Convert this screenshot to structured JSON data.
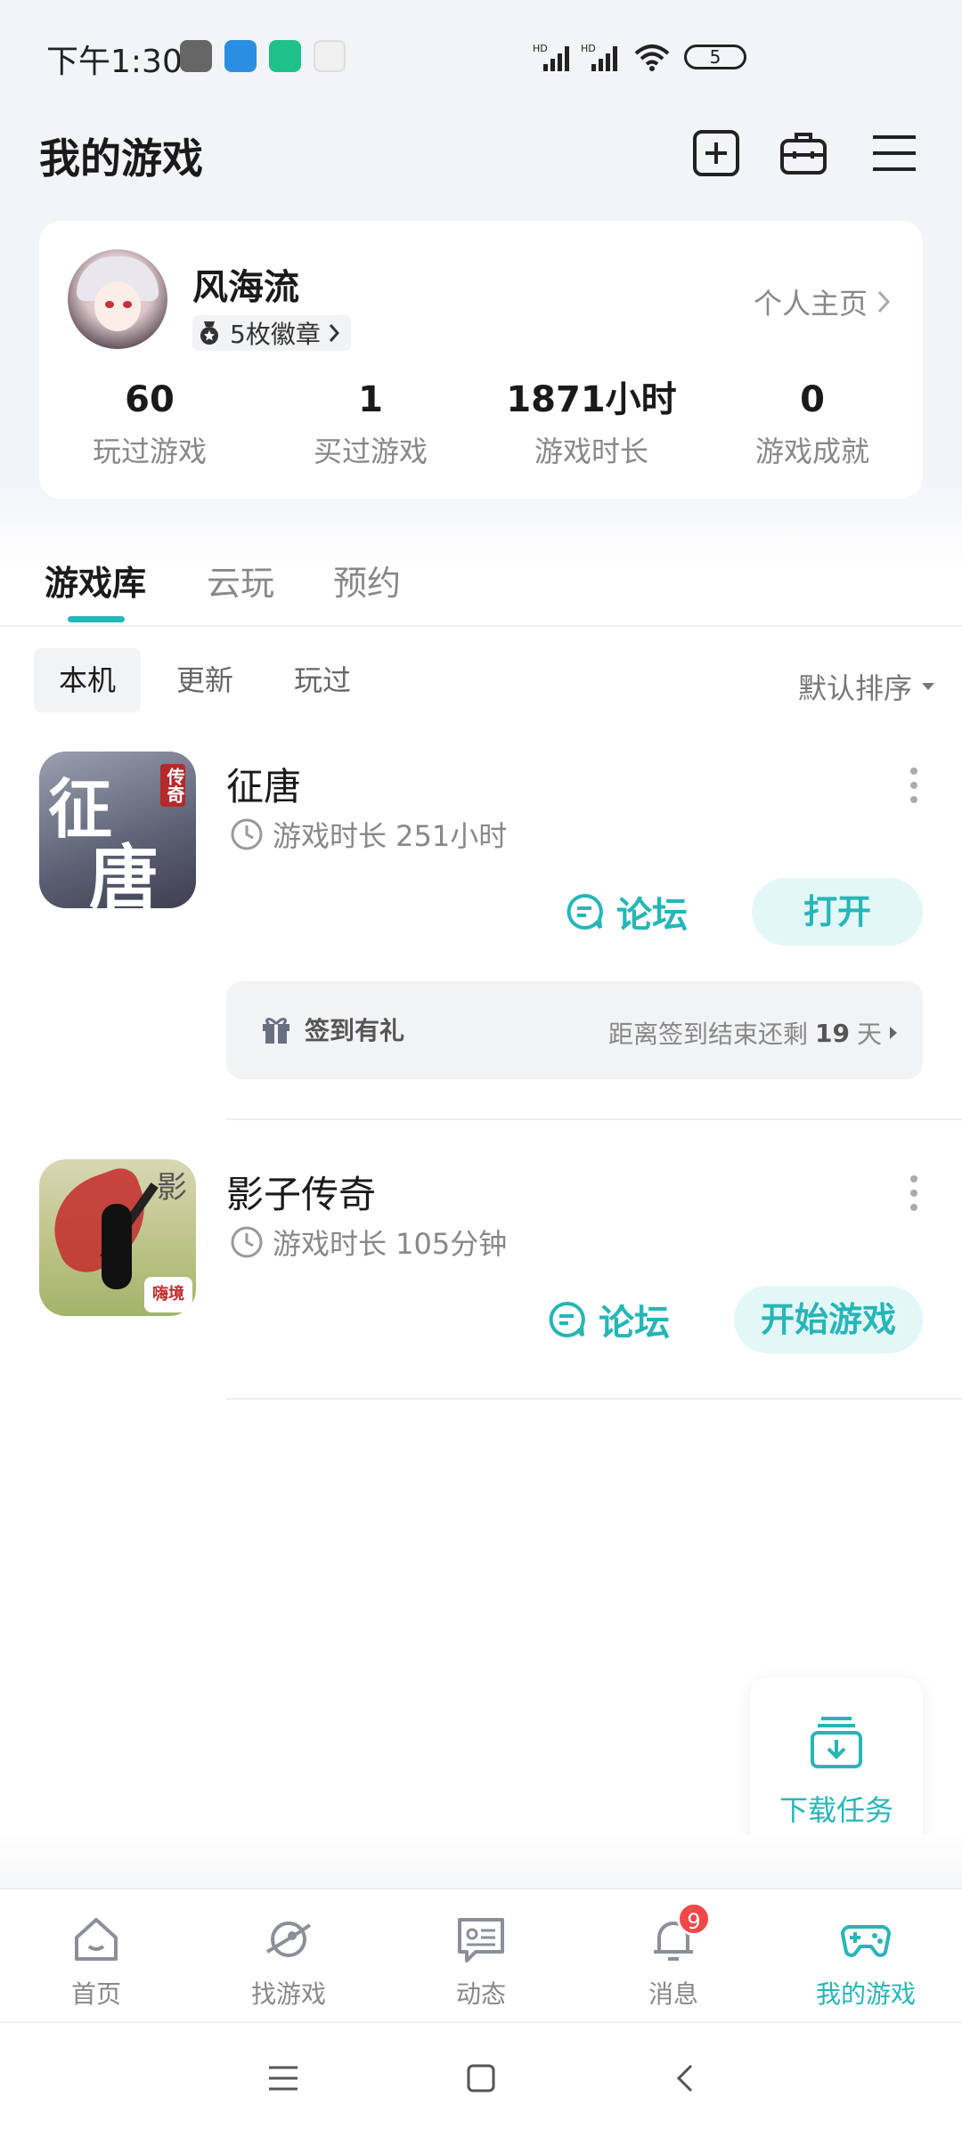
{
  "status_bar": {
    "time": "下午1:30",
    "battery": "5",
    "signal_labels": [
      "HD",
      "HD"
    ]
  },
  "header": {
    "title": "我的游戏"
  },
  "profile": {
    "username": "风海流",
    "badges": "5枚徽章",
    "profile_link": "个人主页",
    "stats": [
      {
        "value": "60",
        "label": "玩过游戏"
      },
      {
        "value": "1",
        "label": "买过游戏"
      },
      {
        "value": "1871小时",
        "label": "游戏时长"
      },
      {
        "value": "0",
        "label": "游戏成就"
      }
    ]
  },
  "tabs": [
    {
      "label": "游戏库",
      "active": true
    },
    {
      "label": "云玩",
      "active": false
    },
    {
      "label": "预约",
      "active": false
    }
  ],
  "filters": {
    "chips": [
      {
        "label": "本机",
        "active": true
      },
      {
        "label": "更新",
        "active": false
      },
      {
        "label": "玩过",
        "active": false
      }
    ],
    "sort_label": "默认排序"
  },
  "games": [
    {
      "name": "征唐",
      "playtime": "游戏时长 251小时",
      "icon_text": [
        "征",
        "唐",
        "传奇"
      ],
      "forum_label": "论坛",
      "action_label": "打开",
      "signin": {
        "label": "签到有礼",
        "remain_prefix": "距离签到结束还剩",
        "remain_days": "19",
        "remain_suffix": "天"
      }
    },
    {
      "name": "影子传奇",
      "playtime": "游戏时长 105分钟",
      "icon_text": [
        "影",
        "嗨境"
      ],
      "forum_label": "论坛",
      "action_label": "开始游戏"
    }
  ],
  "float_button": {
    "label": "下载任务"
  },
  "bottom_nav": [
    {
      "label": "首页",
      "icon": "home-icon",
      "active": false
    },
    {
      "label": "找游戏",
      "icon": "planet-icon",
      "active": false
    },
    {
      "label": "动态",
      "icon": "message-card-icon",
      "active": false
    },
    {
      "label": "消息",
      "icon": "bell-icon",
      "active": false,
      "badge": "9"
    },
    {
      "label": "我的游戏",
      "icon": "gamepad-icon",
      "active": true
    }
  ],
  "colors": {
    "accent": "#26b6b8",
    "badge": "#f04848",
    "background": "#f2f4f7"
  }
}
